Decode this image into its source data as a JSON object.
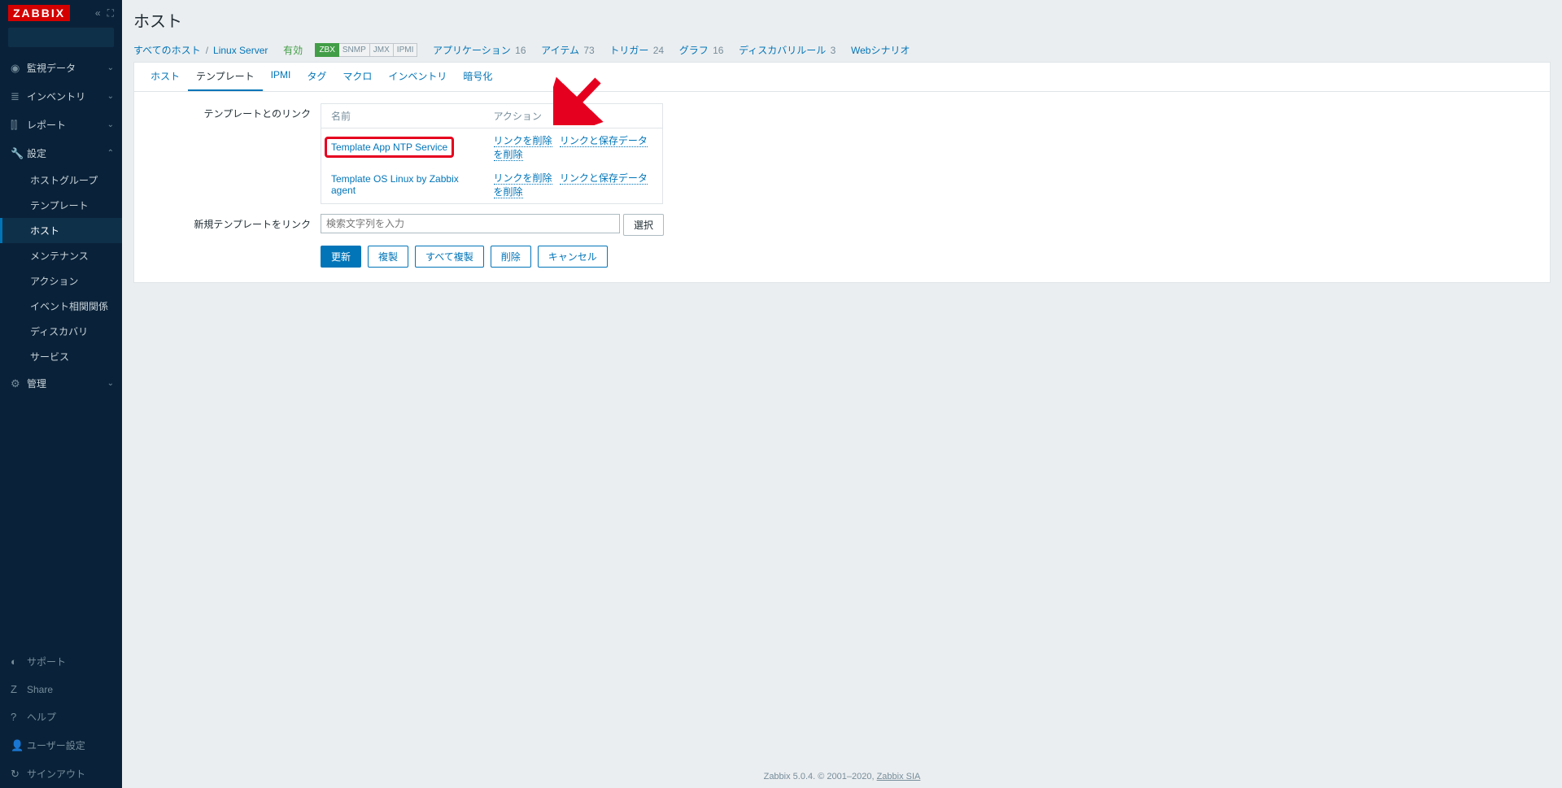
{
  "logo": "ZABBIX",
  "sidebar": {
    "search_placeholder": "",
    "groups": [
      {
        "icon": "◉",
        "label": "監視データ"
      },
      {
        "icon": "≣",
        "label": "インベントリ"
      },
      {
        "icon": "⫿⫿",
        "label": "レポート"
      },
      {
        "icon": "🔧",
        "label": "設定",
        "open": true
      },
      {
        "icon": "⚙",
        "label": "管理"
      }
    ],
    "config_items": [
      "ホストグループ",
      "テンプレート",
      "ホスト",
      "メンテナンス",
      "アクション",
      "イベント相関関係",
      "ディスカバリ",
      "サービス"
    ],
    "bottom": [
      {
        "icon": "◐",
        "label": "サポート"
      },
      {
        "icon": "Z",
        "label": "Share"
      },
      {
        "icon": "?",
        "label": "ヘルプ"
      },
      {
        "icon": "👤",
        "label": "ユーザー設定"
      },
      {
        "icon": "↻",
        "label": "サインアウト"
      }
    ]
  },
  "page_title": "ホスト",
  "breadcrumb": {
    "all_hosts": "すべてのホスト",
    "host": "Linux Server",
    "status": "有効",
    "badges": [
      "ZBX",
      "SNMP",
      "JMX",
      "IPMI"
    ],
    "links": [
      {
        "label": "アプリケーション",
        "count": "16"
      },
      {
        "label": "アイテム",
        "count": "73"
      },
      {
        "label": "トリガー",
        "count": "24"
      },
      {
        "label": "グラフ",
        "count": "16"
      },
      {
        "label": "ディスカバリルール",
        "count": "3"
      },
      {
        "label": "Webシナリオ",
        "count": ""
      }
    ]
  },
  "tabs": [
    "ホスト",
    "テンプレート",
    "IPMI",
    "タグ",
    "マクロ",
    "インベントリ",
    "暗号化"
  ],
  "form": {
    "label_linked": "テンプレートとのリンク",
    "col_name": "名前",
    "col_action": "アクション",
    "rows": [
      {
        "name": "Template App NTP Service",
        "unlink": "リンクを削除",
        "unlink_clear": "リンクと保存データを削除"
      },
      {
        "name": "Template OS Linux by Zabbix agent",
        "unlink": "リンクを削除",
        "unlink_clear": "リンクと保存データを削除"
      }
    ],
    "label_new": "新規テンプレートをリンク",
    "search_placeholder": "検索文字列を入力",
    "select_btn": "選択"
  },
  "buttons": {
    "update": "更新",
    "clone": "複製",
    "full_clone": "すべて複製",
    "delete": "削除",
    "cancel": "キャンセル"
  },
  "footer": {
    "text": "Zabbix 5.0.4. © 2001–2020, ",
    "link": "Zabbix SIA"
  }
}
